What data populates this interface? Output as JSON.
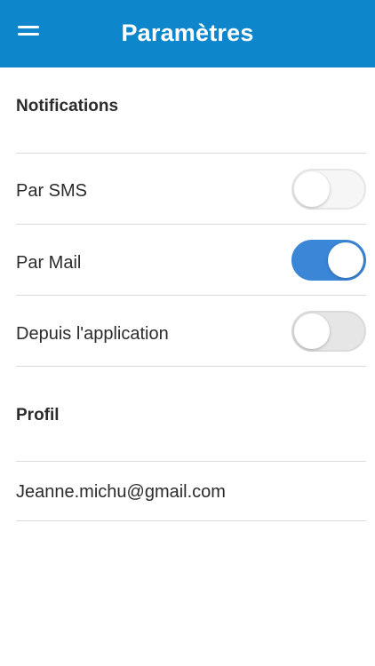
{
  "header": {
    "title": "Paramètres",
    "background_color": "#0d86cc",
    "menu_icon": "hamburger-menu-icon"
  },
  "notifications": {
    "title": "Notifications",
    "items": [
      {
        "label": "Par SMS",
        "enabled": false
      },
      {
        "label": "Par Mail",
        "enabled": true
      },
      {
        "label": "Depuis l'application",
        "enabled": false
      }
    ]
  },
  "profile": {
    "title": "Profil",
    "email": "Jeanne.michu@gmail.com"
  },
  "colors": {
    "toggle_on": "#3b86d6",
    "toggle_off": "#f2f2f2",
    "divider": "#dcdcdc"
  }
}
